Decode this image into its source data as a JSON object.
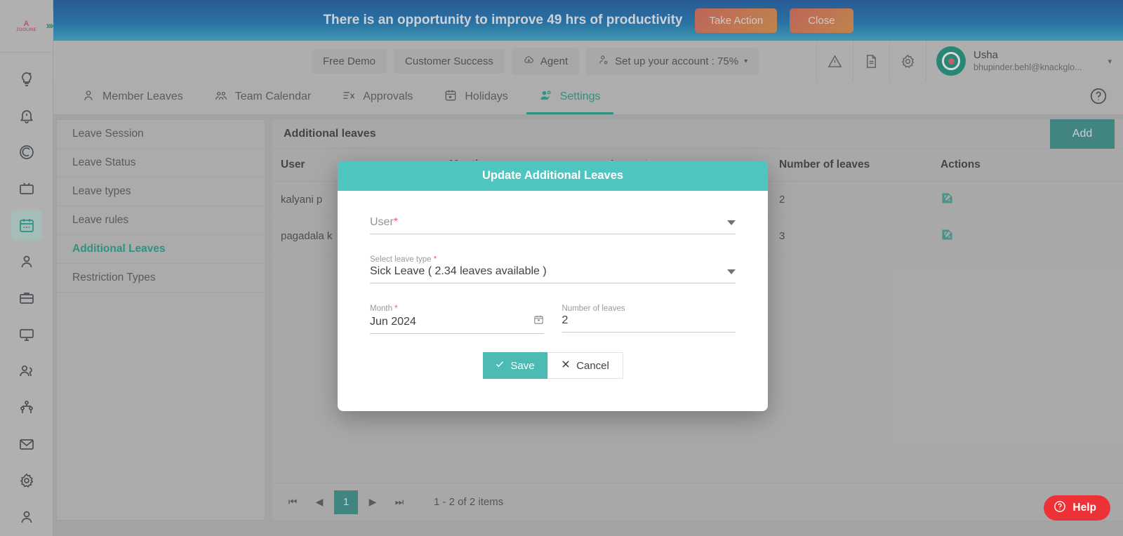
{
  "banner": {
    "message": "There is an opportunity to improve 49 hrs of productivity",
    "take_action_label": "Take Action",
    "close_label": "Close"
  },
  "branding": {
    "logo_mark": "A",
    "logo_text": "ZOOLINE",
    "expand_icon": "›››"
  },
  "rail": {
    "items": [
      {
        "name": "insights-icon",
        "label": "Insights"
      },
      {
        "name": "alerts-icon",
        "label": "Alerts"
      },
      {
        "name": "goals-icon",
        "label": "Goals"
      },
      {
        "name": "screen-recording-icon",
        "label": "Recordings"
      },
      {
        "name": "calendar-icon",
        "label": "Leave",
        "active": true
      },
      {
        "name": "profile-icon",
        "label": "Profile"
      },
      {
        "name": "briefcase-icon",
        "label": "Projects"
      },
      {
        "name": "monitor-icon",
        "label": "Devices"
      },
      {
        "name": "users-icon",
        "label": "Teams"
      },
      {
        "name": "org-chart-icon",
        "label": "Organization"
      },
      {
        "name": "mail-icon",
        "label": "Mail"
      },
      {
        "name": "settings-gear-icon",
        "label": "Settings"
      },
      {
        "name": "account-icon",
        "label": "Account"
      }
    ]
  },
  "topnav": {
    "free_demo": "Free Demo",
    "customer_success": "Customer Success",
    "agent": "Agent",
    "setup_account": "Set up your account : 75%",
    "caret": "▾"
  },
  "profile": {
    "name": "Usha",
    "email": "bhupinder.behl@knackglo...",
    "caret": "▾"
  },
  "tabs": [
    {
      "label": "Member Leaves",
      "icon": "user-icon",
      "active": false
    },
    {
      "label": "Team Calendar",
      "icon": "team-icon",
      "active": false
    },
    {
      "label": "Approvals",
      "icon": "approvals-icon",
      "active": false
    },
    {
      "label": "Holidays",
      "icon": "holiday-calendar-icon",
      "active": false
    },
    {
      "label": "Settings",
      "icon": "settings-people-icon",
      "active": true
    }
  ],
  "settings_menu": {
    "items": [
      {
        "label": "Leave Session",
        "active": false
      },
      {
        "label": "Leave Status",
        "active": false
      },
      {
        "label": "Leave types",
        "active": false
      },
      {
        "label": "Leave rules",
        "active": false
      },
      {
        "label": "Additional Leaves",
        "active": true
      },
      {
        "label": "Restriction Types",
        "active": false
      }
    ]
  },
  "panel": {
    "title": "Additional leaves",
    "add_label": "Add",
    "columns": [
      "User",
      "Month",
      "Leave type",
      "Number of leaves",
      "Actions"
    ],
    "rows": [
      {
        "user": "kalyani p",
        "month": "",
        "leave_type": "",
        "number_of_leaves": "2",
        "action": "edit-icon"
      },
      {
        "user": "pagadala k",
        "month": "",
        "leave_type": "",
        "number_of_leaves": "3",
        "action": "edit-icon"
      }
    ],
    "pager": {
      "first": "⏮",
      "prev": "◀",
      "page": "1",
      "next": "▶",
      "last": "⏭",
      "info": "1 - 2 of 2 items"
    }
  },
  "modal": {
    "title": "Update Additional Leaves",
    "user_label": "User",
    "user_placeholder": "User",
    "user_value": "",
    "leave_type_label": "Select leave type",
    "leave_type_value": "Sick Leave ( 2.34 leaves available )",
    "month_label": "Month",
    "month_value": "Jun 2024",
    "number_label": "Number of leaves",
    "number_value": "2",
    "save_label": "Save",
    "cancel_label": "Cancel",
    "required_mark": "*"
  },
  "help_widget": {
    "label": "Help"
  },
  "colors": {
    "teal": "#2e8a84",
    "modal_teal": "#4ec5c0",
    "accent_green": "#129b87",
    "help_red": "#ec3237",
    "required_red": "#e8607a"
  }
}
